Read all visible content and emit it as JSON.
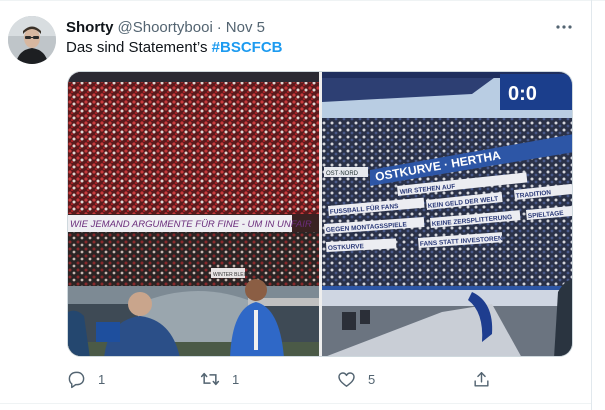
{
  "tweet": {
    "author": {
      "display_name": "Shorty",
      "handle": "@Shoortybooi"
    },
    "separator": "·",
    "timestamp": "Nov 5",
    "text": {
      "body": "Das sind Statement’s ",
      "hashtag": "#BSCFCB"
    },
    "icons": {
      "more": "more-horizontal-icon",
      "reply": "reply-bubble-icon",
      "retweet": "retweet-arrows-icon",
      "like": "heart-icon",
      "share": "share-upload-icon"
    },
    "media": {
      "left_photo": {
        "banner_text": "WIE JEMAND ARGUMENTE FÜR FINE - UM IN UNFAIR",
        "small_sign": "WINTER BLEIBT"
      },
      "right_photo": {
        "scoreboard": "0:0",
        "main_banner": "OSTKURVE · HERTHA",
        "side_sign": "OST·NORD",
        "signs": [
          "WIR STEHEN AUF",
          "FUSSBALL FÜR FANS",
          "KEIN GELD DER WELT",
          "TRADITION",
          "GEGEN MONTAGSSPIELE",
          "KEINE ZERSPLITTERUNG",
          "SPIELTAGE",
          "OSTKURVE",
          "FANS STATT INVESTOREN"
        ]
      }
    },
    "stats": {
      "replies": "1",
      "retweets": "1",
      "likes": "5"
    },
    "colors": {
      "accent": "#1d9bf0",
      "secondary_text": "#536471",
      "primary_text": "#0f1419"
    }
  }
}
